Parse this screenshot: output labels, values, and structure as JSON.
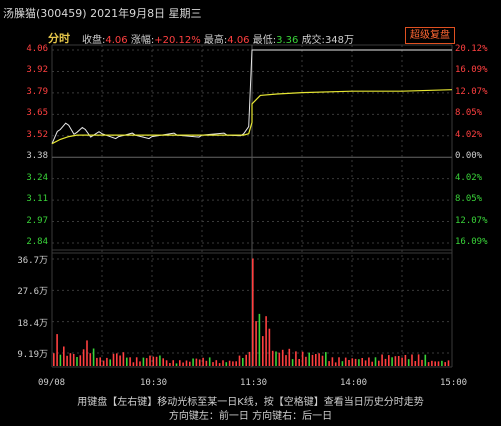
{
  "window_title": "汤臊猫(300459) 2021年9月8日 星期三",
  "header": {
    "mode_label": "分时",
    "close_label": "收盘:",
    "close_value": "4.06",
    "change_label": "涨幅:",
    "change_value": "+20.12%",
    "high_label": "最高:",
    "high_value": "4.06",
    "low_label": "最低:",
    "low_value": "3.36",
    "volume_label": "成交:",
    "volume_value": "348万"
  },
  "replay_button": "超级复盘",
  "price_axis_left": [
    "4.06",
    "3.92",
    "3.79",
    "3.65",
    "3.52",
    "3.38",
    "3.24",
    "3.11",
    "2.97",
    "2.84"
  ],
  "price_axis_right": [
    "20.12%",
    "16.09%",
    "12.07%",
    "8.05%",
    "4.02%",
    "0.00%",
    "4.02%",
    "8.05%",
    "12.07%",
    "16.09%"
  ],
  "volume_axis": [
    "36.7万",
    "27.6万",
    "18.4万",
    "9.19万"
  ],
  "time_axis": [
    "09/08",
    "10:30",
    "11:30",
    "14:00",
    "15:00"
  ],
  "help_text_line1": "用键盘【左右键】移动光标至某一日K线，按【空格键】查看当日历史分时走势",
  "help_text_line2": "方向键左：前一日    方向键右：后一日",
  "colors": {
    "up": "#ff4040",
    "down": "#39d339",
    "price_line": "#e8e8e8",
    "avg_line": "#e6e633",
    "grid": "#3a3a3a",
    "accent": "#e5c64a"
  },
  "chart_data": {
    "type": "line",
    "prev_close": 3.38,
    "x": [
      "09:30",
      "09:35",
      "09:40",
      "09:45",
      "09:50",
      "09:55",
      "10:00",
      "10:10",
      "10:20",
      "10:30",
      "10:45",
      "11:00",
      "11:15",
      "11:25",
      "11:28",
      "11:30",
      "13:00",
      "13:05",
      "13:15",
      "13:30",
      "14:00",
      "14:30",
      "15:00"
    ],
    "series": [
      {
        "values": [
          3.4,
          3.5,
          3.53,
          3.48,
          3.5,
          3.46,
          3.47,
          3.45,
          3.46,
          3.45,
          3.46,
          3.46,
          3.46,
          3.47,
          3.52,
          4.06,
          4.06,
          4.06,
          4.06,
          4.06,
          4.06,
          4.06,
          4.06
        ]
      },
      {
        "values": [
          3.4,
          3.43,
          3.45,
          3.46,
          3.46,
          3.46,
          3.46,
          3.46,
          3.46,
          3.46,
          3.46,
          3.46,
          3.46,
          3.46,
          3.47,
          3.55,
          3.68,
          3.74,
          3.75,
          3.76,
          3.77,
          3.77,
          3.78
        ]
      }
    ],
    "volume": [
      11,
      7,
      5,
      4,
      9,
      6,
      3,
      5,
      3,
      4,
      2,
      3,
      2,
      4,
      9,
      37,
      27,
      18,
      6,
      5,
      3,
      4,
      2
    ],
    "ylim": [
      2.7,
      4.06
    ],
    "volume_max": 36.7
  }
}
